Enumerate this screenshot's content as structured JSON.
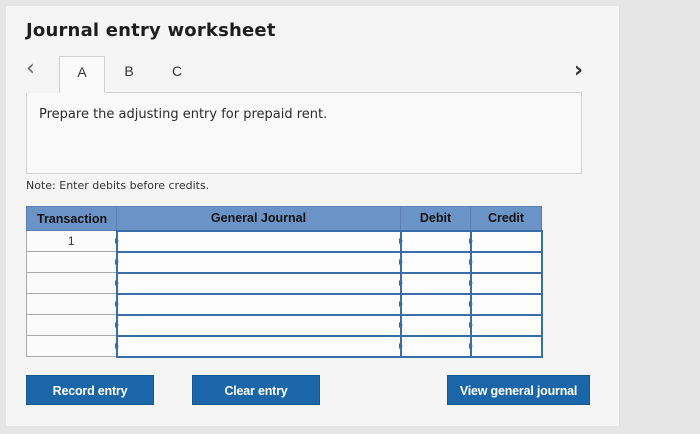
{
  "worksheet": {
    "title": "Journal entry worksheet",
    "prev_arrow": "‹",
    "next_arrow": "›",
    "tabs": [
      {
        "label": "A",
        "active": true
      },
      {
        "label": "B",
        "active": false
      },
      {
        "label": "C",
        "active": false
      }
    ],
    "prompt": "Prepare the adjusting entry for prepaid rent.",
    "note": "Note: Enter debits before credits."
  },
  "table": {
    "headers": [
      "Transaction",
      "General Journal",
      "Debit",
      "Credit"
    ],
    "rows": [
      {
        "transaction": "1",
        "account": "",
        "debit": "",
        "credit": ""
      },
      {
        "transaction": "",
        "account": "",
        "debit": "",
        "credit": ""
      },
      {
        "transaction": "",
        "account": "",
        "debit": "",
        "credit": ""
      },
      {
        "transaction": "",
        "account": "",
        "debit": "",
        "credit": ""
      },
      {
        "transaction": "",
        "account": "",
        "debit": "",
        "credit": ""
      },
      {
        "transaction": "",
        "account": "",
        "debit": "",
        "credit": ""
      }
    ]
  },
  "buttons": {
    "record": "Record entry",
    "clear": "Clear entry",
    "view": "View general journal"
  },
  "colors": {
    "header_blue": "#6a94c8",
    "button_blue": "#1b66a9"
  }
}
